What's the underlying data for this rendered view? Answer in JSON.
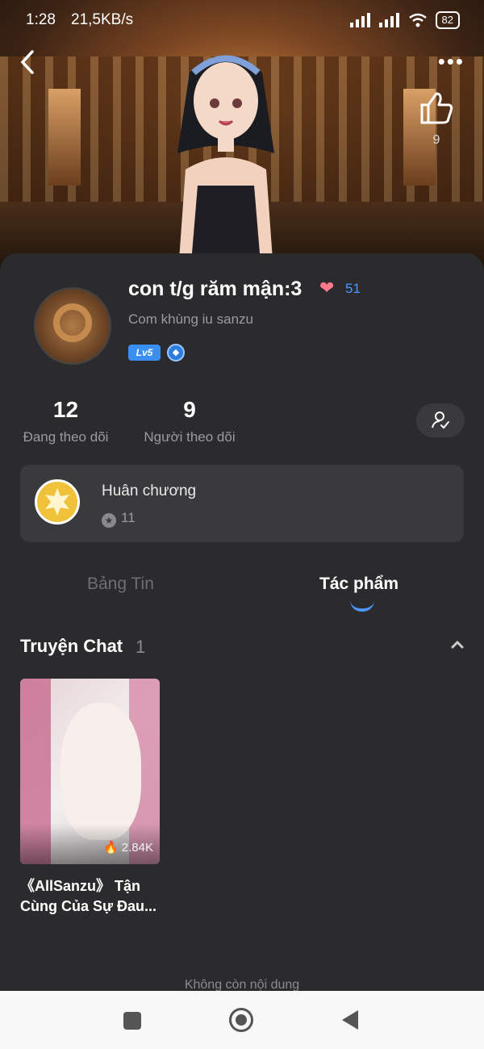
{
  "status_bar": {
    "time": "1:28",
    "network_rate": "21,5KB/s",
    "battery": "82"
  },
  "header": {
    "like_count": "9"
  },
  "profile": {
    "name": "con t/g răm mận:3",
    "heart_count": "51",
    "bio": "Com khùng iu sanzu",
    "level": "Lv5"
  },
  "stats": [
    {
      "value": "12",
      "label": "Đang theo dõi"
    },
    {
      "value": "9",
      "label": "Người theo dõi"
    }
  ],
  "medal": {
    "title": "Huân chương",
    "count": "11"
  },
  "tabs": [
    {
      "label": "Bảng Tin",
      "active": false
    },
    {
      "label": "Tác phẩm",
      "active": true
    }
  ],
  "section": {
    "title": "Truyện Chat",
    "count": "1"
  },
  "works": [
    {
      "title": "《AllSanzu》 Tận Cùng Của Sự Đau...",
      "views": "2.84K"
    }
  ],
  "footer": {
    "end_text": "Không còn nội dung"
  },
  "colors": {
    "accent": "#4a97ff",
    "background": "#2b2b2d",
    "card": "#3a3a3d"
  }
}
